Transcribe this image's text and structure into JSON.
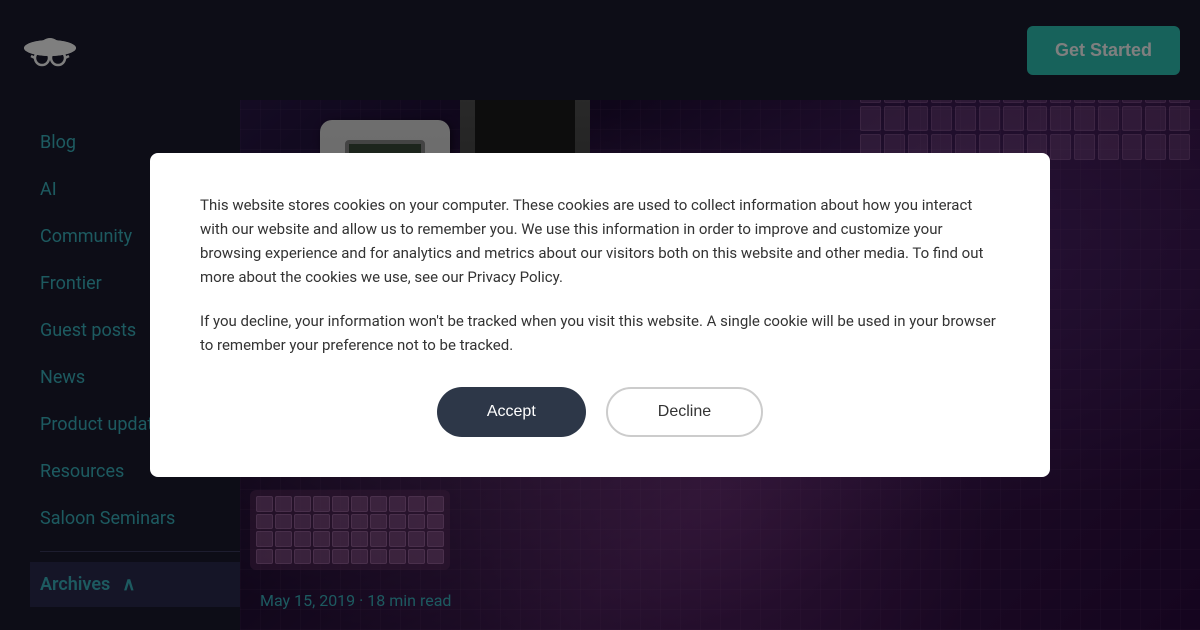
{
  "header": {
    "logo_alt": "Hat and glasses logo",
    "get_started_label": "Get Started"
  },
  "sidebar": {
    "items": [
      {
        "id": "blog",
        "label": "Blog"
      },
      {
        "id": "ai",
        "label": "AI"
      },
      {
        "id": "community",
        "label": "Community"
      },
      {
        "id": "frontier",
        "label": "Frontier"
      },
      {
        "id": "guest-posts",
        "label": "Guest posts"
      },
      {
        "id": "news",
        "label": "News"
      },
      {
        "id": "product-updates",
        "label": "Product updates"
      },
      {
        "id": "resources",
        "label": "Resources"
      },
      {
        "id": "saloon-seminars",
        "label": "Saloon Seminars"
      },
      {
        "id": "archives",
        "label": "Archives",
        "active": true,
        "has_arrow": true
      }
    ]
  },
  "hero": {
    "date": "May 15, 2019",
    "read_time": "18 min read",
    "meta_text": "May 15, 2019 · 18 min read"
  },
  "cookie_modal": {
    "paragraph1": "This website stores cookies on your computer. These cookies are used to collect information about how you interact with our website and allow us to remember you. We use this information in order to improve and customize your browsing experience and for analytics and metrics about our visitors both on this website and other media. To find out more about the cookies we use, see our Privacy Policy.",
    "paragraph2": "If you decline, your information won't be tracked when you visit this website. A single cookie will be used in your browser to remember your preference not to be tracked.",
    "accept_label": "Accept",
    "decline_label": "Decline"
  }
}
